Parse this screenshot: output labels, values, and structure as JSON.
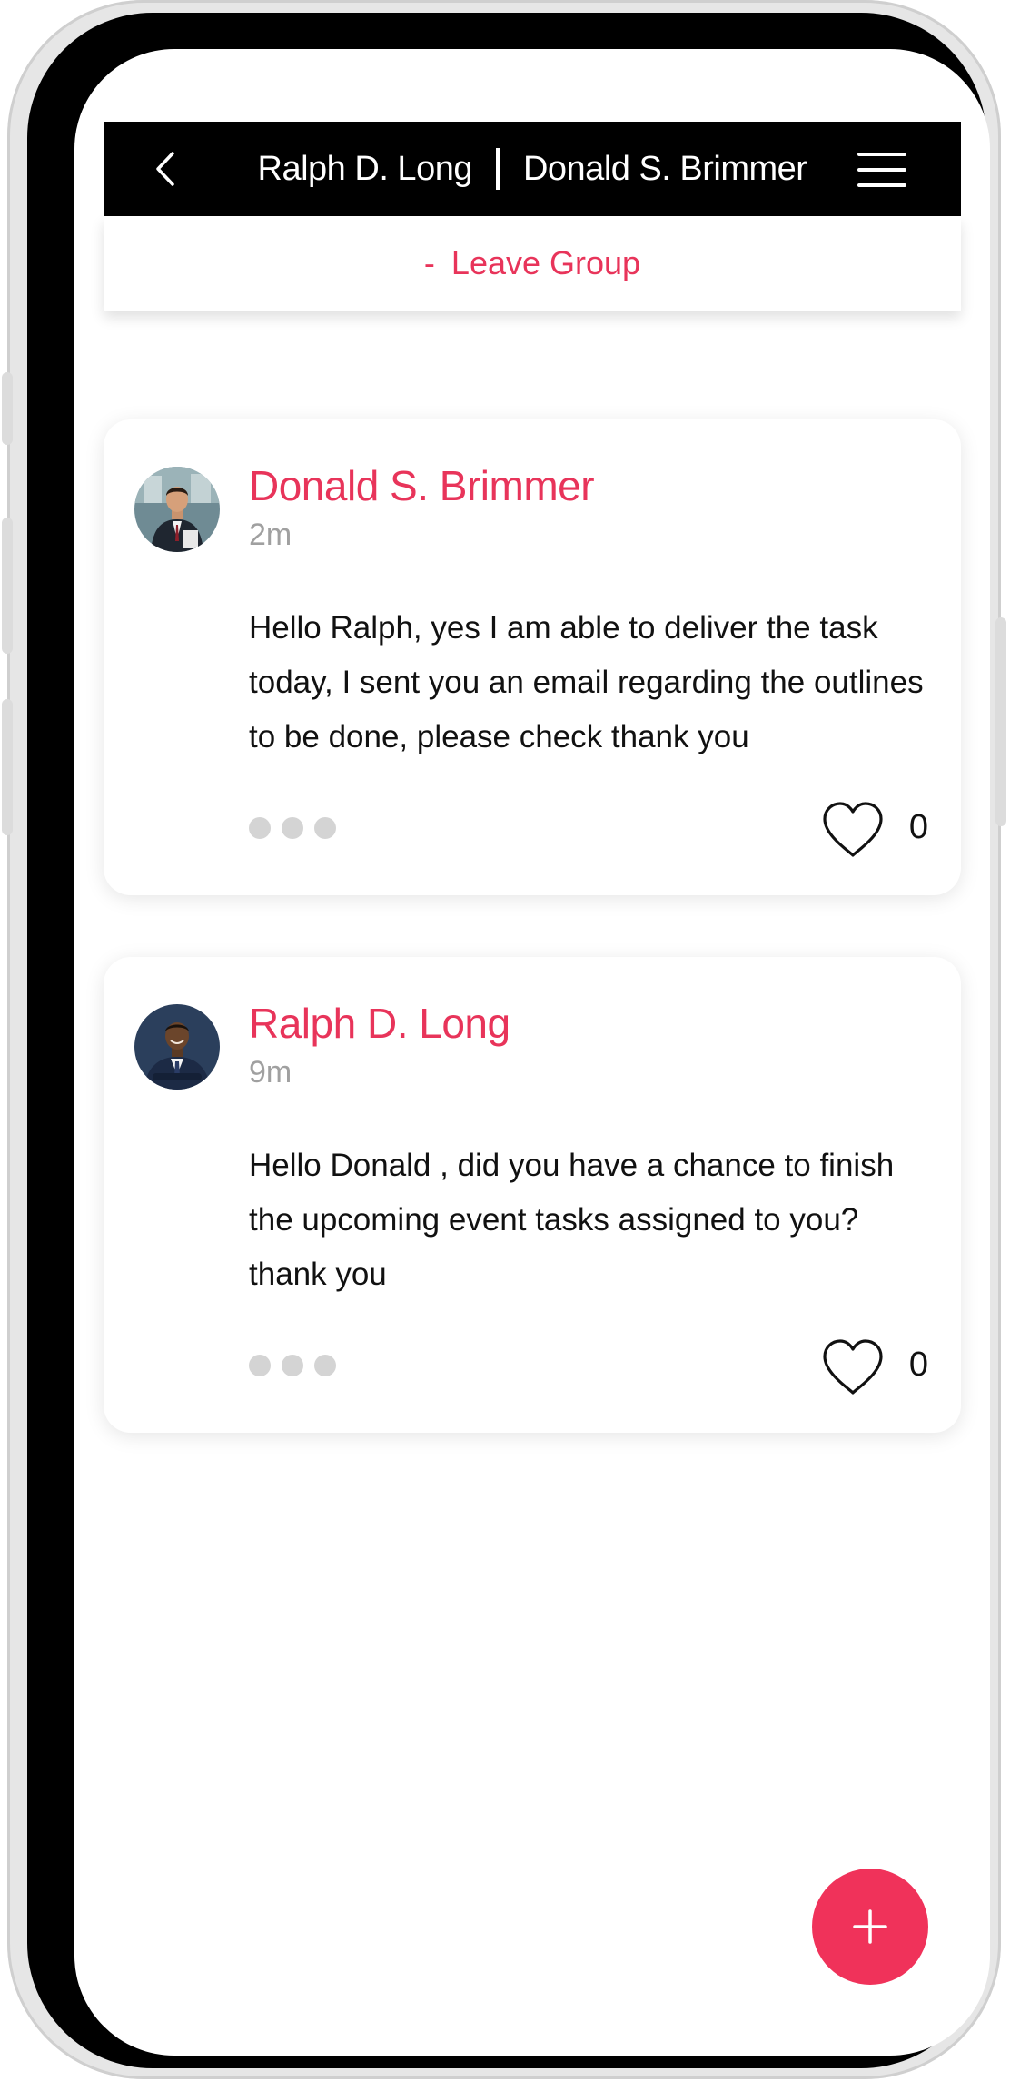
{
  "header": {
    "participant_1": "Ralph D. Long",
    "participant_2": "Donald S. Brimmer"
  },
  "leave_group": {
    "prefix": "-",
    "label": "Leave Group"
  },
  "messages": [
    {
      "author": "Donald S. Brimmer",
      "time": "2m",
      "text": "Hello Ralph, yes I am able to deliver the task today, I sent you an email regarding the outlines to be done, please check thank you",
      "likes": "0"
    },
    {
      "author": "Ralph D. Long",
      "time": "9m",
      "text": "Hello Donald , did you have a chance to finish the upcoming event tasks assigned to you? thank you",
      "likes": "0"
    }
  ],
  "icons": {
    "back": "chevron-left-icon",
    "menu": "hamburger-menu-icon",
    "like": "heart-icon",
    "more": "more-dots-icon",
    "add": "plus-icon"
  },
  "colors": {
    "accent": "#e8345a",
    "header_bg": "#000000",
    "fab": "#f0325a"
  }
}
